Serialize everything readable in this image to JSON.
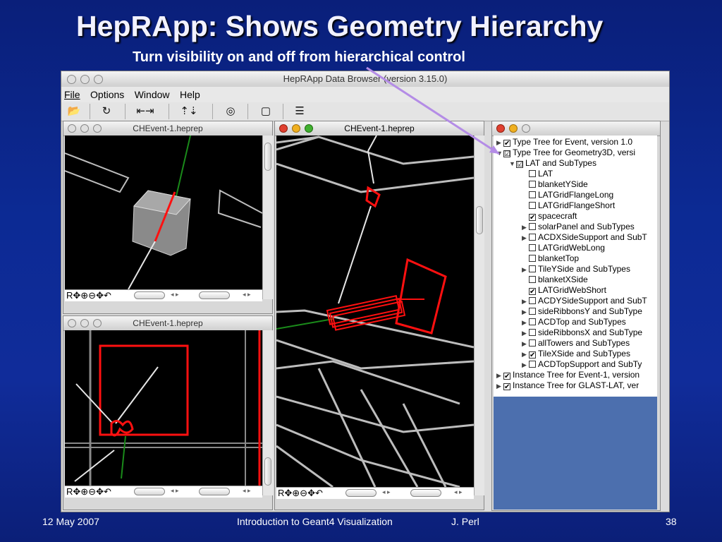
{
  "slide": {
    "title": "HepRApp: Shows Geometry Hierarchy",
    "subtitle": "Turn visibility on and off from hierarchical control",
    "footer_date": "12 May 2007",
    "footer_center": "Introduction to Geant4 Visualization",
    "footer_author": "J. Perl",
    "footer_page": "38"
  },
  "app": {
    "window_title": "HepRApp Data Browser (version 3.15.0)",
    "menus": [
      "File",
      "Options",
      "Window",
      "Help"
    ],
    "toolbar_icons": [
      "open-folder-icon",
      "reload-icon",
      "back-forward-icon",
      "up-down-icon",
      "spin-icon",
      "document-icon",
      "tree-icon"
    ],
    "toolbar_glyphs": [
      "📂",
      "↻",
      "⇤⇥",
      "⇡⇣",
      "◎",
      "▢",
      "☰"
    ]
  },
  "views": [
    {
      "title": "CHEvent-1.heprep",
      "controls": "R✥⊕⊖✥↶"
    },
    {
      "title": "CHEvent-1.heprep",
      "controls": "R✥⊕⊖✥↶"
    },
    {
      "title": "CHEvent-1.heprep",
      "controls": "R✥⊕⊖✥↶"
    }
  ],
  "tree": {
    "items": [
      {
        "label": "Type Tree for Event, version 1.0",
        "indent": 0,
        "expander": "▶",
        "checked": "✔"
      },
      {
        "label": "Type Tree for Geometry3D, versi",
        "indent": 0,
        "expander": "▼",
        "checked": "☑"
      },
      {
        "label": "LAT and SubTypes",
        "indent": 1,
        "expander": "▼",
        "checked": "☑"
      },
      {
        "label": "LAT",
        "indent": 2,
        "expander": "",
        "checked": ""
      },
      {
        "label": "blanketYSide",
        "indent": 2,
        "expander": "",
        "checked": ""
      },
      {
        "label": "LATGridFlangeLong",
        "indent": 2,
        "expander": "",
        "checked": ""
      },
      {
        "label": "LATGridFlangeShort",
        "indent": 2,
        "expander": "",
        "checked": ""
      },
      {
        "label": "spacecraft",
        "indent": 2,
        "expander": "",
        "checked": "✔"
      },
      {
        "label": "solarPanel and SubTypes",
        "indent": 2,
        "expander": "▶",
        "checked": ""
      },
      {
        "label": "ACDXSideSupport and SubT",
        "indent": 2,
        "expander": "▶",
        "checked": ""
      },
      {
        "label": "LATGridWebLong",
        "indent": 2,
        "expander": "",
        "checked": ""
      },
      {
        "label": "blanketTop",
        "indent": 2,
        "expander": "",
        "checked": ""
      },
      {
        "label": "TileYSide and SubTypes",
        "indent": 2,
        "expander": "▶",
        "checked": ""
      },
      {
        "label": "blanketXSide",
        "indent": 2,
        "expander": "",
        "checked": ""
      },
      {
        "label": "LATGridWebShort",
        "indent": 2,
        "expander": "",
        "checked": "✔"
      },
      {
        "label": "ACDYSideSupport and SubT",
        "indent": 2,
        "expander": "▶",
        "checked": ""
      },
      {
        "label": "sideRibbonsY and SubType",
        "indent": 2,
        "expander": "▶",
        "checked": ""
      },
      {
        "label": "ACDTop and SubTypes",
        "indent": 2,
        "expander": "▶",
        "checked": ""
      },
      {
        "label": "sideRibbonsX and SubType",
        "indent": 2,
        "expander": "▶",
        "checked": ""
      },
      {
        "label": "allTowers and SubTypes",
        "indent": 2,
        "expander": "▶",
        "checked": ""
      },
      {
        "label": "TileXSide and SubTypes",
        "indent": 2,
        "expander": "▶",
        "checked": "✔"
      },
      {
        "label": "ACDTopSupport and SubTy",
        "indent": 2,
        "expander": "▶",
        "checked": ""
      },
      {
        "label": "Instance Tree for Event-1, version",
        "indent": 0,
        "expander": "▶",
        "checked": "✔"
      },
      {
        "label": "Instance Tree for GLAST-LAT, ver",
        "indent": 0,
        "expander": "▶",
        "checked": "✔"
      }
    ]
  },
  "colors": {
    "accent_arrow": "#b48ce6",
    "track_red": "#ff1010",
    "geometry_grey": "#bdbdbd"
  }
}
